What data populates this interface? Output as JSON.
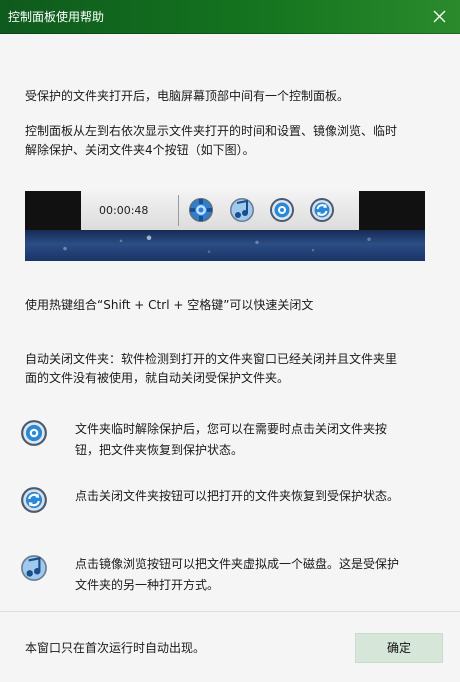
{
  "window": {
    "title": "控制面板使用帮助",
    "close_icon": "close-icon"
  },
  "intro": {
    "line1": "受保护的文件夹打开后，电脑屏幕顶部中间有一个控制面板。",
    "line2a": "控制面板从左到右依次显示文件夹打开的时间和设置、镜像浏览、临时",
    "line2b": "解除保护、关闭文件夹4个按钮（如下图）。"
  },
  "panel_preview": {
    "time": "00:00:48",
    "icons": [
      "gear-icon",
      "mirror-browse-icon",
      "unlock-icon",
      "refresh-close-icon"
    ]
  },
  "hotkey_text": "使用热键组合“Shift + Ctrl + 空格键”可以快速关闭文",
  "auto_close": {
    "line1": "自动关闭文件夹：软件检测到打开的文件夹窗口已经关闭并且文件夹里",
    "line2": "面的文件没有被使用，就自动关闭受保护文件夹。"
  },
  "features": [
    {
      "icon": "unlock-icon",
      "line1": "文件夹临时解除保护后，您可以在需要时点击关闭文件夹按",
      "line2": "钮，把文件夹恢复到保护状态。"
    },
    {
      "icon": "refresh-close-icon",
      "line1": "点击关闭文件夹按钮可以把打开的文件夹恢复到受保护状态。",
      "line2": ""
    },
    {
      "icon": "mirror-browse-icon",
      "line1": "点击镜像浏览按钮可以把文件夹虚拟成一个磁盘。这是受保护",
      "line2": "文件夹的另一种打开方式。"
    }
  ],
  "footer": {
    "note": "本窗口只在首次运行时自动出现。",
    "ok_label": "确定"
  },
  "colors": {
    "titlebar": "#14741f",
    "ok_button": "#d6e6d9",
    "background": "#f5f5f5"
  }
}
